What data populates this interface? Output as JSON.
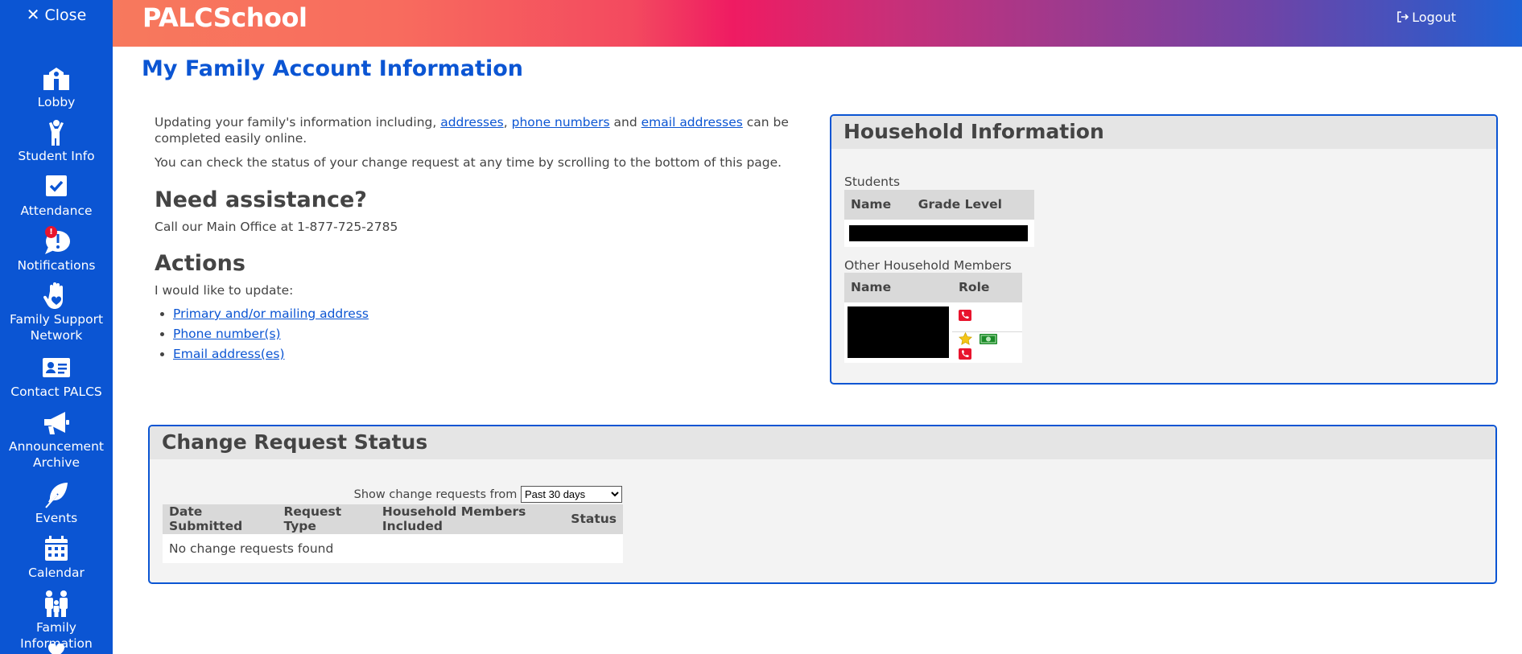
{
  "sidebar": {
    "close_label": "Close",
    "items": [
      {
        "label": "Lobby",
        "icon": "school-icon"
      },
      {
        "label": "Student Info",
        "icon": "student-icon"
      },
      {
        "label": "Attendance",
        "icon": "checkbox-icon"
      },
      {
        "label": "Notifications",
        "icon": "notification-bubble-icon",
        "badge": "!"
      },
      {
        "label": "Family Support Network",
        "icon": "hand-heart-icon"
      },
      {
        "label": "Contact PALCS",
        "icon": "contact-card-icon"
      },
      {
        "label": "Announcement Archive",
        "icon": "megaphone-icon"
      },
      {
        "label": "Events",
        "icon": "feather-icon"
      },
      {
        "label": "Calendar",
        "icon": "calendar-icon"
      },
      {
        "label": "Family Information",
        "icon": "family-icon"
      }
    ]
  },
  "header": {
    "brand": "PALCSchool",
    "logout_label": "Logout"
  },
  "page_title": "My Family Account Information",
  "intro": {
    "prefix": "Updating your family's information including, ",
    "link_addresses": "addresses",
    "comma": ",",
    "link_phone": "phone numbers",
    "and": " and ",
    "link_email": "email addresses",
    "suffix": " can be completed easily online.",
    "status_note": "You can check the status of your change request at any time by scrolling to the bottom of this page."
  },
  "assistance": {
    "heading": "Need assistance?",
    "text": "Call our Main Office at 1-877-725-2785"
  },
  "actions": {
    "heading": "Actions",
    "prompt": "I would like to update:",
    "links": [
      "Primary and/or mailing address",
      "Phone number(s)",
      "Email address(es)"
    ]
  },
  "household": {
    "title": "Household Information",
    "students_label": "Students",
    "students_columns": [
      "Name",
      "Grade Level"
    ],
    "members_label": "Other Household Members",
    "members_columns": [
      "Name",
      "Role"
    ]
  },
  "change_requests": {
    "title": "Change Request Status",
    "filter_label": "Show change requests from",
    "filter_value": "Past 30 days",
    "columns": [
      "Date Submitted",
      "Request Type",
      "Household Members Included",
      "Status"
    ],
    "empty_text": "No change requests found"
  },
  "colors": {
    "sidebar": "#0b55d3",
    "title": "#0b55d3",
    "phone_badge": "#e8142d",
    "star": "#f5c518",
    "money": "#1a8a28"
  }
}
